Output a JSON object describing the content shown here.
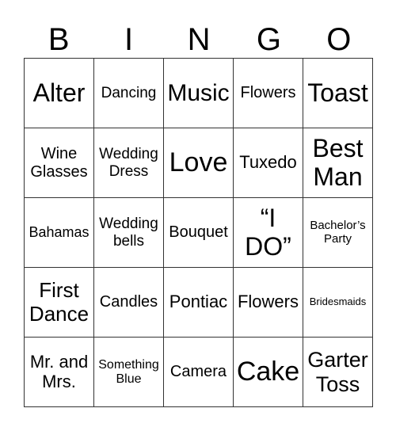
{
  "header": [
    "B",
    "I",
    "N",
    "G",
    "O"
  ],
  "cells": [
    [
      "Alter",
      "Dancing",
      "Music",
      "Flowers",
      "Toast"
    ],
    [
      "Wine\nGlasses",
      "Wedding\nDress",
      "Love",
      "Tuxedo",
      "Best\nMan"
    ],
    [
      "Bahamas",
      "Wedding\nbells",
      "Bouquet",
      "“I\nDO”",
      "Bachelor’s\nParty"
    ],
    [
      "First\nDance",
      "Candles",
      "Pontiac",
      "Flowers",
      "Bridesmaids"
    ],
    [
      "Mr. and\nMrs.",
      "Something\nBlue",
      "Camera",
      "Cake",
      "Garter\nToss"
    ]
  ]
}
